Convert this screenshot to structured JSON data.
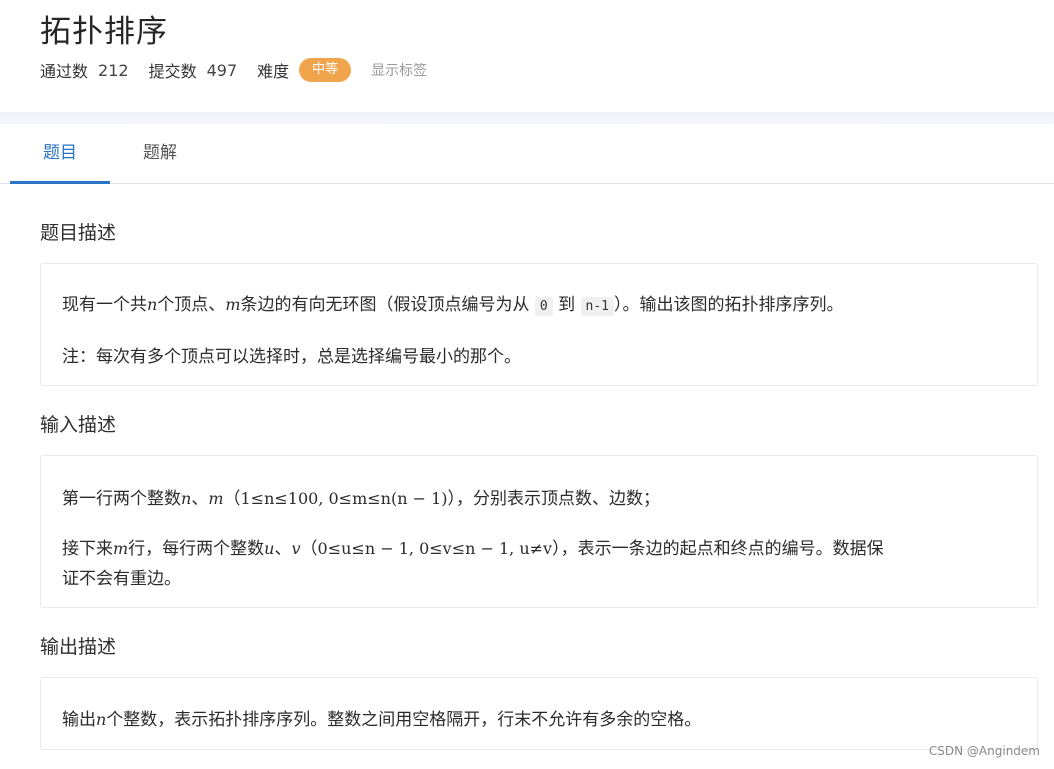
{
  "problem": {
    "title": "拓扑排序",
    "stats": {
      "pass_label": "通过数",
      "pass_value": "212",
      "submit_label": "提交数",
      "submit_value": "497",
      "difficulty_label": "难度",
      "difficulty": "中等",
      "show_tags": "显示标签"
    }
  },
  "tabs": [
    {
      "label": "题目"
    },
    {
      "label": "题解"
    }
  ],
  "colors": {
    "accent": "#2a73c5",
    "difficulty_badge": "#f0a54c"
  },
  "description": {
    "title": "题目描述",
    "line1": {
      "a": "现有一个共",
      "n": "n",
      "b": "个顶点、",
      "m": "m",
      "c": "条边的有向无环图（假设顶点编号为从",
      "code0": "0",
      "d": "到",
      "code1": "n-1",
      "e": "）。输出该图的拓扑排序序列。"
    },
    "line2": "注：每次有多个顶点可以选择时，总是选择编号最小的那个。"
  },
  "input": {
    "title": "输入描述",
    "line1": {
      "a": "第一行两个整数",
      "n": "n",
      "sep": "、",
      "m": "m",
      "paren_open": "（",
      "expr": "1≤n≤100, 0≤m≤n(n − 1)",
      "paren_close": "）",
      "b": "，分别表示顶点数、边数；"
    },
    "line2": {
      "a": "接下来",
      "m": "m",
      "b": "行，每行两个整数",
      "u": "u",
      "sep": "、",
      "v": "v",
      "paren_open": "（",
      "expr": "0≤u≤n − 1, 0≤v≤n − 1, u≠v",
      "paren_close": "）",
      "c": "，表示一条边的起点和终点的编号。数据保"
    },
    "line3": "证不会有重边。"
  },
  "output": {
    "title": "输出描述",
    "line1": {
      "a": "输出",
      "n": "n",
      "b": "个整数，表示拓扑排序序列。整数之间用空格隔开，行末不允许有多余的空格。"
    }
  },
  "watermark": "CSDN @Angindem"
}
